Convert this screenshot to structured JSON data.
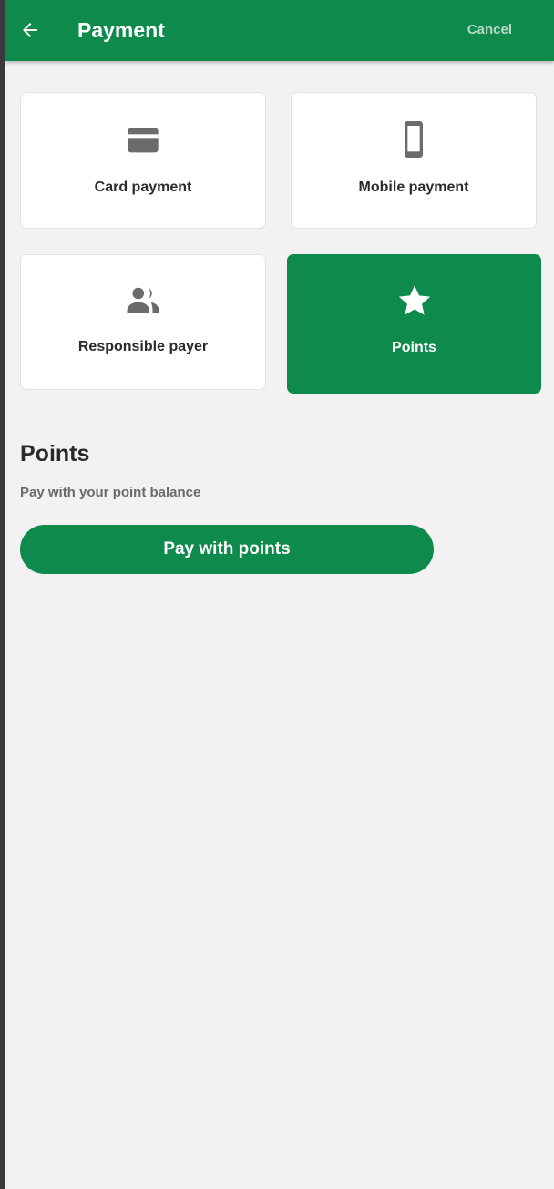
{
  "header": {
    "title": "Payment",
    "cancel_label": "Cancel",
    "back_icon": "arrow-left-icon"
  },
  "payment_methods": [
    {
      "label": "Card payment",
      "icon": "credit-card-icon",
      "selected": false
    },
    {
      "label": "Mobile payment",
      "icon": "smartphone-icon",
      "selected": false
    },
    {
      "label": "Responsible payer",
      "icon": "people-icon",
      "selected": false
    },
    {
      "label": "Points",
      "icon": "star-icon",
      "selected": true
    }
  ],
  "section": {
    "title": "Points",
    "subtitle": "Pay with your point balance",
    "button_label": "Pay with points"
  },
  "colors": {
    "brand_green": "#0e8a4d",
    "background": "#f3f1f2",
    "icon_gray": "#6b6b6b"
  }
}
